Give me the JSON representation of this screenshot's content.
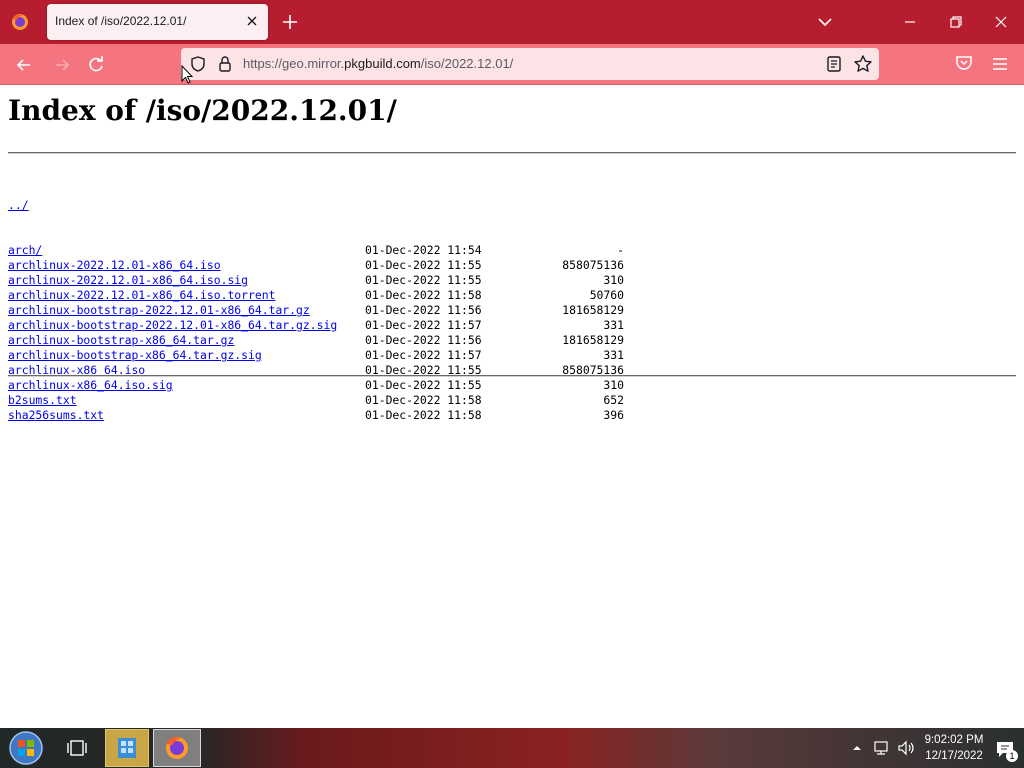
{
  "browser": {
    "tab_title": "Index of /iso/2022.12.01/",
    "url_prefix": "https://geo.mirror.",
    "url_host": "pkgbuild.com",
    "url_path": "/iso/2022.12.01/",
    "colors": {
      "tabbar": "#b61e30",
      "navbar": "#f47480",
      "urlbar": "#fce3e6"
    }
  },
  "page": {
    "title": "Index of /iso/2022.12.01/",
    "parent_link": "../",
    "entries": [
      {
        "name": "arch/",
        "date": "01-Dec-2022 11:54",
        "size": "-"
      },
      {
        "name": "archlinux-2022.12.01-x86_64.iso",
        "date": "01-Dec-2022 11:55",
        "size": "858075136"
      },
      {
        "name": "archlinux-2022.12.01-x86_64.iso.sig",
        "date": "01-Dec-2022 11:55",
        "size": "310"
      },
      {
        "name": "archlinux-2022.12.01-x86_64.iso.torrent",
        "date": "01-Dec-2022 11:58",
        "size": "50760"
      },
      {
        "name": "archlinux-bootstrap-2022.12.01-x86_64.tar.gz",
        "date": "01-Dec-2022 11:56",
        "size": "181658129"
      },
      {
        "name": "archlinux-bootstrap-2022.12.01-x86_64.tar.gz.sig",
        "date": "01-Dec-2022 11:57",
        "size": "331"
      },
      {
        "name": "archlinux-bootstrap-x86_64.tar.gz",
        "date": "01-Dec-2022 11:56",
        "size": "181658129"
      },
      {
        "name": "archlinux-bootstrap-x86_64.tar.gz.sig",
        "date": "01-Dec-2022 11:57",
        "size": "331"
      },
      {
        "name": "archlinux-x86_64.iso",
        "date": "01-Dec-2022 11:55",
        "size": "858075136"
      },
      {
        "name": "archlinux-x86_64.iso.sig",
        "date": "01-Dec-2022 11:55",
        "size": "310"
      },
      {
        "name": "b2sums.txt",
        "date": "01-Dec-2022 11:58",
        "size": "652"
      },
      {
        "name": "sha256sums.txt",
        "date": "01-Dec-2022 11:58",
        "size": "396"
      }
    ]
  },
  "taskbar": {
    "time": "9:02:02 PM",
    "date": "12/17/2022",
    "notification_count": "1"
  }
}
